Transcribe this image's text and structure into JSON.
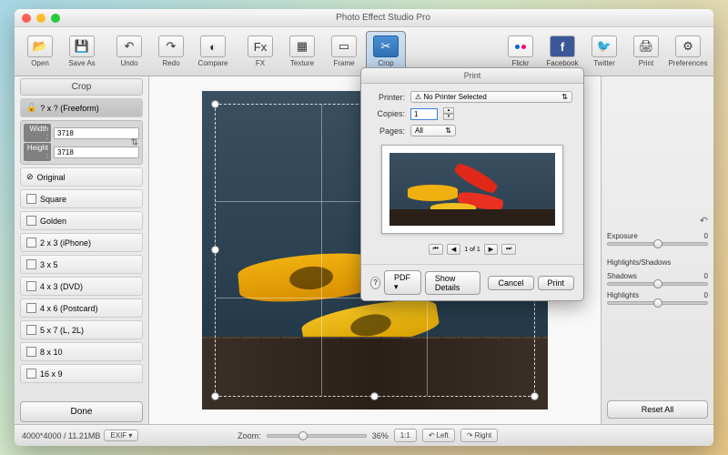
{
  "window": {
    "title": "Photo Effect Studio Pro"
  },
  "toolbar": {
    "open": "Open",
    "saveas": "Save As",
    "undo": "Undo",
    "redo": "Redo",
    "compare": "Compare",
    "fx": "FX",
    "texture": "Texture",
    "frame": "Frame",
    "crop": "Crop",
    "flickr": "Flickr",
    "facebook": "Facebook",
    "twitter": "Twitter",
    "print": "Print",
    "preferences": "Preferences"
  },
  "sidebar": {
    "title": "Crop",
    "freeform": "? x ?  (Freeform)",
    "width_label": "Width :",
    "width_value": "3718",
    "height_label": "Height :",
    "height_value": "3718",
    "ratios": [
      {
        "label": "Original"
      },
      {
        "label": "Square"
      },
      {
        "label": "Golden"
      },
      {
        "label": "2 x 3  (iPhone)"
      },
      {
        "label": "3 x 5"
      },
      {
        "label": "4 x 3  (DVD)"
      },
      {
        "label": "4 x 6  (Postcard)"
      },
      {
        "label": "5 x 7  (L, 2L)"
      },
      {
        "label": "8 x 10"
      },
      {
        "label": "16 x 9"
      }
    ],
    "done": "Done"
  },
  "right": {
    "exposure": "Exposure",
    "exposure_val": "0",
    "hlsh": "Highlights/Shadows",
    "shadows": "Shadows",
    "shadows_val": "0",
    "highlights": "Highlights",
    "highlights_val": "0",
    "reset": "Reset All"
  },
  "status": {
    "dims": "4000*4000 / 11.21MB",
    "exif": "EXIF",
    "zoom_label": "Zoom:",
    "zoom_value": "36%",
    "fit": "1:1",
    "left": "Left",
    "right": "Right"
  },
  "print": {
    "title": "Print",
    "printer_label": "Printer:",
    "printer_value": "No Printer Selected",
    "copies_label": "Copies:",
    "copies_value": "1",
    "pages_label": "Pages:",
    "pages_value": "All",
    "page_nav": "1 of 1",
    "help": "?",
    "pdf": "PDF",
    "show_details": "Show Details",
    "cancel": "Cancel",
    "print_btn": "Print"
  }
}
